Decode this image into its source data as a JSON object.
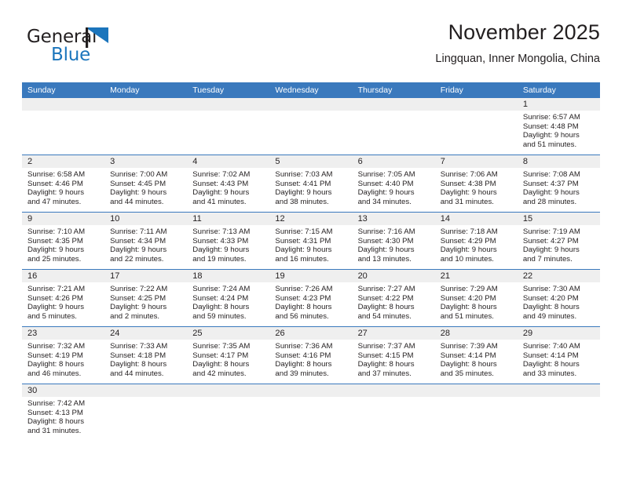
{
  "brand": {
    "name_top": "General",
    "name_bottom": "Blue",
    "accent_color": "#1b75bc"
  },
  "header": {
    "title": "November 2025",
    "subtitle": "Lingquan, Inner Mongolia, China"
  },
  "theme": {
    "header_row_color": "#3a79bd",
    "day_band_color": "#efefef",
    "text_color": "#231f20"
  },
  "weekdays": [
    "Sunday",
    "Monday",
    "Tuesday",
    "Wednesday",
    "Thursday",
    "Friday",
    "Saturday"
  ],
  "weeks": [
    [
      {
        "day": "",
        "lines": []
      },
      {
        "day": "",
        "lines": []
      },
      {
        "day": "",
        "lines": []
      },
      {
        "day": "",
        "lines": []
      },
      {
        "day": "",
        "lines": []
      },
      {
        "day": "",
        "lines": []
      },
      {
        "day": "1",
        "lines": [
          "Sunrise: 6:57 AM",
          "Sunset: 4:48 PM",
          "Daylight: 9 hours",
          "and 51 minutes."
        ]
      }
    ],
    [
      {
        "day": "2",
        "lines": [
          "Sunrise: 6:58 AM",
          "Sunset: 4:46 PM",
          "Daylight: 9 hours",
          "and 47 minutes."
        ]
      },
      {
        "day": "3",
        "lines": [
          "Sunrise: 7:00 AM",
          "Sunset: 4:45 PM",
          "Daylight: 9 hours",
          "and 44 minutes."
        ]
      },
      {
        "day": "4",
        "lines": [
          "Sunrise: 7:02 AM",
          "Sunset: 4:43 PM",
          "Daylight: 9 hours",
          "and 41 minutes."
        ]
      },
      {
        "day": "5",
        "lines": [
          "Sunrise: 7:03 AM",
          "Sunset: 4:41 PM",
          "Daylight: 9 hours",
          "and 38 minutes."
        ]
      },
      {
        "day": "6",
        "lines": [
          "Sunrise: 7:05 AM",
          "Sunset: 4:40 PM",
          "Daylight: 9 hours",
          "and 34 minutes."
        ]
      },
      {
        "day": "7",
        "lines": [
          "Sunrise: 7:06 AM",
          "Sunset: 4:38 PM",
          "Daylight: 9 hours",
          "and 31 minutes."
        ]
      },
      {
        "day": "8",
        "lines": [
          "Sunrise: 7:08 AM",
          "Sunset: 4:37 PM",
          "Daylight: 9 hours",
          "and 28 minutes."
        ]
      }
    ],
    [
      {
        "day": "9",
        "lines": [
          "Sunrise: 7:10 AM",
          "Sunset: 4:35 PM",
          "Daylight: 9 hours",
          "and 25 minutes."
        ]
      },
      {
        "day": "10",
        "lines": [
          "Sunrise: 7:11 AM",
          "Sunset: 4:34 PM",
          "Daylight: 9 hours",
          "and 22 minutes."
        ]
      },
      {
        "day": "11",
        "lines": [
          "Sunrise: 7:13 AM",
          "Sunset: 4:33 PM",
          "Daylight: 9 hours",
          "and 19 minutes."
        ]
      },
      {
        "day": "12",
        "lines": [
          "Sunrise: 7:15 AM",
          "Sunset: 4:31 PM",
          "Daylight: 9 hours",
          "and 16 minutes."
        ]
      },
      {
        "day": "13",
        "lines": [
          "Sunrise: 7:16 AM",
          "Sunset: 4:30 PM",
          "Daylight: 9 hours",
          "and 13 minutes."
        ]
      },
      {
        "day": "14",
        "lines": [
          "Sunrise: 7:18 AM",
          "Sunset: 4:29 PM",
          "Daylight: 9 hours",
          "and 10 minutes."
        ]
      },
      {
        "day": "15",
        "lines": [
          "Sunrise: 7:19 AM",
          "Sunset: 4:27 PM",
          "Daylight: 9 hours",
          "and 7 minutes."
        ]
      }
    ],
    [
      {
        "day": "16",
        "lines": [
          "Sunrise: 7:21 AM",
          "Sunset: 4:26 PM",
          "Daylight: 9 hours",
          "and 5 minutes."
        ]
      },
      {
        "day": "17",
        "lines": [
          "Sunrise: 7:22 AM",
          "Sunset: 4:25 PM",
          "Daylight: 9 hours",
          "and 2 minutes."
        ]
      },
      {
        "day": "18",
        "lines": [
          "Sunrise: 7:24 AM",
          "Sunset: 4:24 PM",
          "Daylight: 8 hours",
          "and 59 minutes."
        ]
      },
      {
        "day": "19",
        "lines": [
          "Sunrise: 7:26 AM",
          "Sunset: 4:23 PM",
          "Daylight: 8 hours",
          "and 56 minutes."
        ]
      },
      {
        "day": "20",
        "lines": [
          "Sunrise: 7:27 AM",
          "Sunset: 4:22 PM",
          "Daylight: 8 hours",
          "and 54 minutes."
        ]
      },
      {
        "day": "21",
        "lines": [
          "Sunrise: 7:29 AM",
          "Sunset: 4:20 PM",
          "Daylight: 8 hours",
          "and 51 minutes."
        ]
      },
      {
        "day": "22",
        "lines": [
          "Sunrise: 7:30 AM",
          "Sunset: 4:20 PM",
          "Daylight: 8 hours",
          "and 49 minutes."
        ]
      }
    ],
    [
      {
        "day": "23",
        "lines": [
          "Sunrise: 7:32 AM",
          "Sunset: 4:19 PM",
          "Daylight: 8 hours",
          "and 46 minutes."
        ]
      },
      {
        "day": "24",
        "lines": [
          "Sunrise: 7:33 AM",
          "Sunset: 4:18 PM",
          "Daylight: 8 hours",
          "and 44 minutes."
        ]
      },
      {
        "day": "25",
        "lines": [
          "Sunrise: 7:35 AM",
          "Sunset: 4:17 PM",
          "Daylight: 8 hours",
          "and 42 minutes."
        ]
      },
      {
        "day": "26",
        "lines": [
          "Sunrise: 7:36 AM",
          "Sunset: 4:16 PM",
          "Daylight: 8 hours",
          "and 39 minutes."
        ]
      },
      {
        "day": "27",
        "lines": [
          "Sunrise: 7:37 AM",
          "Sunset: 4:15 PM",
          "Daylight: 8 hours",
          "and 37 minutes."
        ]
      },
      {
        "day": "28",
        "lines": [
          "Sunrise: 7:39 AM",
          "Sunset: 4:14 PM",
          "Daylight: 8 hours",
          "and 35 minutes."
        ]
      },
      {
        "day": "29",
        "lines": [
          "Sunrise: 7:40 AM",
          "Sunset: 4:14 PM",
          "Daylight: 8 hours",
          "and 33 minutes."
        ]
      }
    ],
    [
      {
        "day": "30",
        "lines": [
          "Sunrise: 7:42 AM",
          "Sunset: 4:13 PM",
          "Daylight: 8 hours",
          "and 31 minutes."
        ]
      },
      {
        "day": "",
        "lines": []
      },
      {
        "day": "",
        "lines": []
      },
      {
        "day": "",
        "lines": []
      },
      {
        "day": "",
        "lines": []
      },
      {
        "day": "",
        "lines": []
      },
      {
        "day": "",
        "lines": []
      }
    ]
  ]
}
